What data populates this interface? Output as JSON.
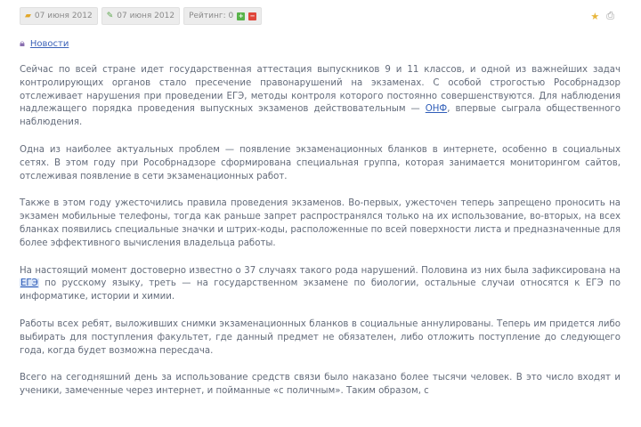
{
  "toolbar": {
    "created_date": "07 июня 2012",
    "modified_date": "07 июня 2012",
    "rating_label": "Рейтинг: 0",
    "plus": "+",
    "minus": "−"
  },
  "icons": {
    "calendar": "calendar-icon",
    "edit": "edit-icon",
    "star": "star-icon",
    "print": "print-icon",
    "lock": "lock-icon"
  },
  "breadcrumb": {
    "link": "Новости"
  },
  "article": {
    "p1_a": "Сейчас по всей стране идет государственная аттестация выпускников 9 и 11 классов, и одной из важнейших задач контролирующих органов стало пресечение правонарушений на экзаменах. С особой строгостью Рособрнадзор отслеживает нарушения при проведении ЕГЭ, методы контроля которого постоянно совершенствуются. Для наблюдения надлежащего порядка проведения выпускных экзаменов действовательным — ",
    "p1_link": "ОНФ",
    "p1_b": ", впервые сыграла общественного наблюдения.",
    "p2": "Одна из наиболее актуальных проблем — появление экзаменационных бланков в интернете, особенно в социальных сетях. В этом году при Рособрнадзоре сформирована специальная группа, которая занимается мониторингом сайтов, отслеживая появление в сети экзаменационных работ.",
    "p3": "Также в этом году ужесточились правила проведения экзаменов. Во-первых, ужесточен теперь запрещено проносить на экзамен мобильные телефоны, тогда как раньше запрет распространялся только на их использование, во-вторых, на всех бланках появились специальные значки и штрих-коды, расположенные по всей поверхности листа и предназначенные для более эффективного вычисления владельца работы.",
    "p4_a": "На настоящий момент достоверно известно о 37 случаях такого рода нарушений. Половина из них была зафиксирована на ",
    "p4_link": "ЕГЭ",
    "p4_b": " по русскому языку, треть — на государственном экзамене по биологии, остальные случаи относятся к ЕГЭ по информатике, истории и химии.",
    "p5": "Работы всех ребят, выложивших снимки экзаменационных бланков в социальные аннулированы. Теперь им придется либо выбирать для поступления факультет, где данный предмет не обязателен, либо отложить поступление до следующего года, когда будет возможна пересдача.",
    "p6": "Всего на сегодняшний день за использование средств связи было наказано более тысячи человек. В это число входят и ученики, замеченные через интернет, и пойманные «с поличным». Таким образом, с"
  }
}
